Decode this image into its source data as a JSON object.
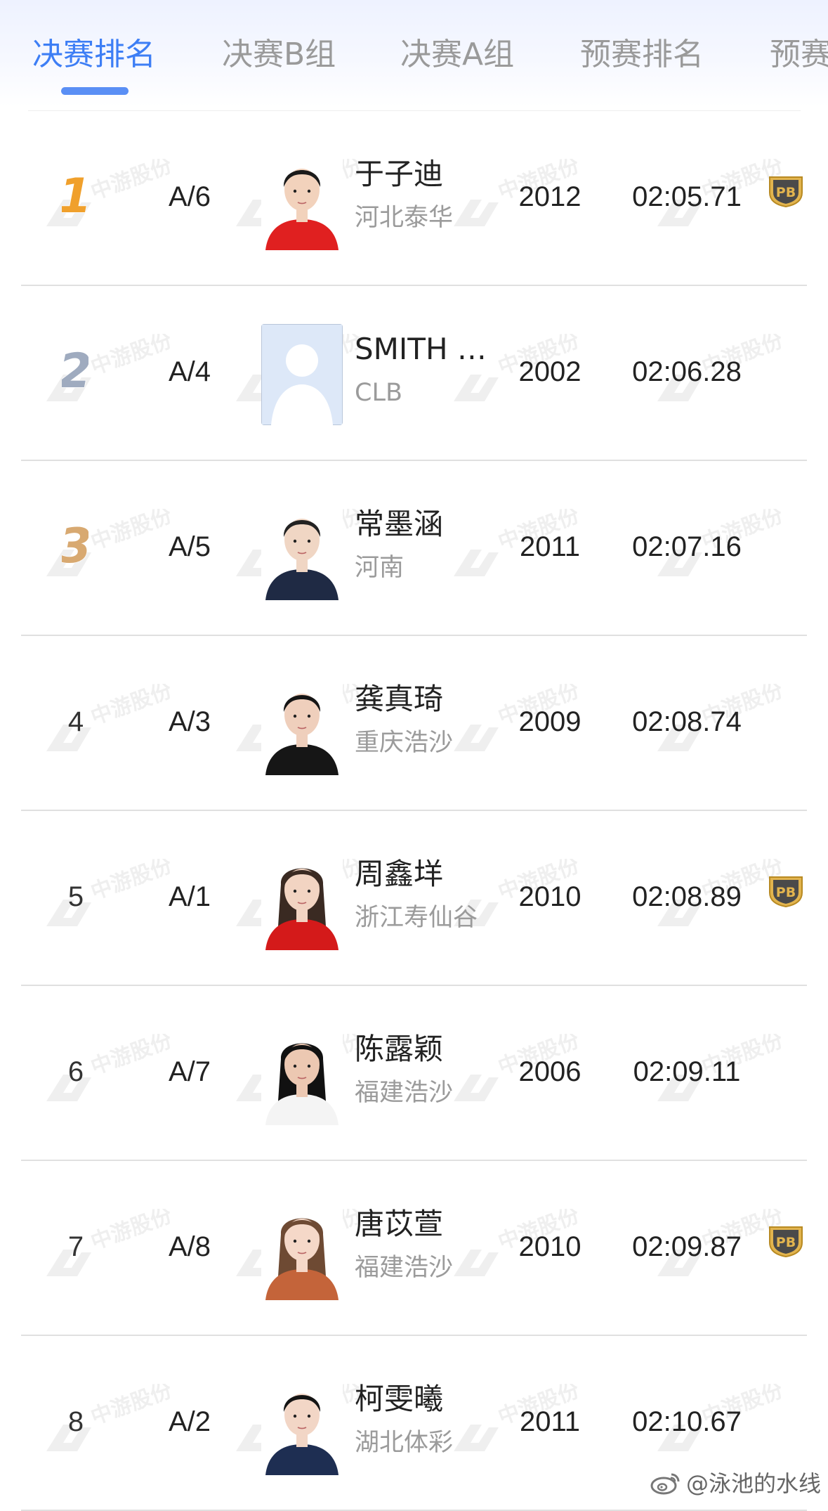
{
  "tabs": [
    {
      "label": "决赛排名",
      "active": true
    },
    {
      "label": "决赛B组",
      "active": false
    },
    {
      "label": "决赛A组",
      "active": false
    },
    {
      "label": "预赛排名",
      "active": false
    },
    {
      "label": "预赛",
      "active": false
    }
  ],
  "watermark": {
    "text": "中游股份"
  },
  "results": [
    {
      "rank": "1",
      "medal": "gold",
      "lane": "A/6",
      "photo": "red-uniform-athlete-photo",
      "name": "于子迪",
      "team": "河北泰华",
      "year": "2012",
      "time": "02:05.71",
      "pb": true
    },
    {
      "rank": "2",
      "medal": "silver",
      "lane": "A/4",
      "photo": "placeholder-avatar",
      "name": "SMITH …",
      "team": "CLB",
      "year": "2002",
      "time": "02:06.28",
      "pb": false
    },
    {
      "rank": "3",
      "medal": "bronze",
      "lane": "A/5",
      "photo": "navy-uniform-athlete-photo",
      "name": "常墨涵",
      "team": "河南",
      "year": "2011",
      "time": "02:07.16",
      "pb": false
    },
    {
      "rank": "4",
      "medal": "",
      "lane": "A/3",
      "photo": "black-hoodie-athlete-photo",
      "name": "龚真琦",
      "team": "重庆浩沙",
      "year": "2009",
      "time": "02:08.74",
      "pb": false
    },
    {
      "rank": "5",
      "medal": "",
      "lane": "A/1",
      "photo": "red-jacket-athlete-photo",
      "name": "周鑫垟",
      "team": "浙江寿仙谷",
      "year": "2010",
      "time": "02:08.89",
      "pb": true
    },
    {
      "rank": "6",
      "medal": "",
      "lane": "A/7",
      "photo": "white-jacket-athlete-photo",
      "name": "陈露颖",
      "team": "福建浩沙",
      "year": "2006",
      "time": "02:09.11",
      "pb": false
    },
    {
      "rank": "7",
      "medal": "",
      "lane": "A/8",
      "photo": "school-uniform-athlete-photo",
      "name": "唐苡萱",
      "team": "福建浩沙",
      "year": "2010",
      "time": "02:09.87",
      "pb": true
    },
    {
      "rank": "8",
      "medal": "",
      "lane": "A/2",
      "photo": "sailor-uniform-athlete-photo",
      "name": "柯雯曦",
      "team": "湖北体彩",
      "year": "2011",
      "time": "02:10.67",
      "pb": false
    }
  ],
  "pb_badge": {
    "label": "PB"
  },
  "footer": {
    "handle": "@泳池的水线",
    "icon": "weibo-icon"
  },
  "colors": {
    "accent": "#3d7ef5",
    "gold": "#f0a02c",
    "silver": "#9fabbf",
    "bronze": "#d8a971",
    "pb_badge": "#e2b44e"
  }
}
